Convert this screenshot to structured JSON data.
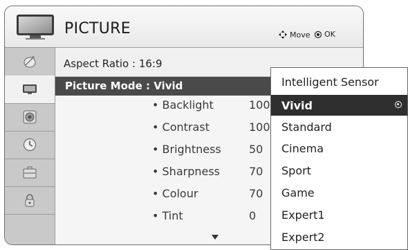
{
  "header": {
    "title": "PICTURE",
    "hint_move": "Move",
    "hint_ok": "OK",
    "icon": "tv-icon"
  },
  "sidebar": {
    "items": [
      {
        "name": "satellite-icon",
        "active": false
      },
      {
        "name": "tv-icon",
        "active": true
      },
      {
        "name": "speaker-icon",
        "active": false
      },
      {
        "name": "clock-icon",
        "active": false
      },
      {
        "name": "toolbox-icon",
        "active": false
      },
      {
        "name": "lock-icon",
        "active": false
      }
    ]
  },
  "content": {
    "aspect_ratio": "Aspect Ratio   : 16:9",
    "picture_mode": "Picture Mode : Vivid",
    "settings": [
      {
        "label": "• Backlight",
        "value": "100"
      },
      {
        "label": "• Contrast",
        "value": "100"
      },
      {
        "label": "• Brightness",
        "value": "50"
      },
      {
        "label": "• Sharpness",
        "value": "70"
      },
      {
        "label": "• Colour",
        "value": "70"
      },
      {
        "label": "• Tint",
        "value": "0"
      }
    ]
  },
  "dropdown": {
    "options": [
      {
        "label": "Intelligent Sensor",
        "selected": false
      },
      {
        "label": "Vivid",
        "selected": true
      },
      {
        "label": "Standard",
        "selected": false
      },
      {
        "label": "Cinema",
        "selected": false
      },
      {
        "label": "Sport",
        "selected": false
      },
      {
        "label": "Game",
        "selected": false
      },
      {
        "label": "Expert1",
        "selected": false
      },
      {
        "label": "Expert2",
        "selected": false
      }
    ]
  },
  "colors": {
    "frame_border": "#6f6f6f",
    "selected_row": "#2f2f2f",
    "mode_row": "#4a4a4a",
    "sidebar": "#c9c9c9"
  }
}
